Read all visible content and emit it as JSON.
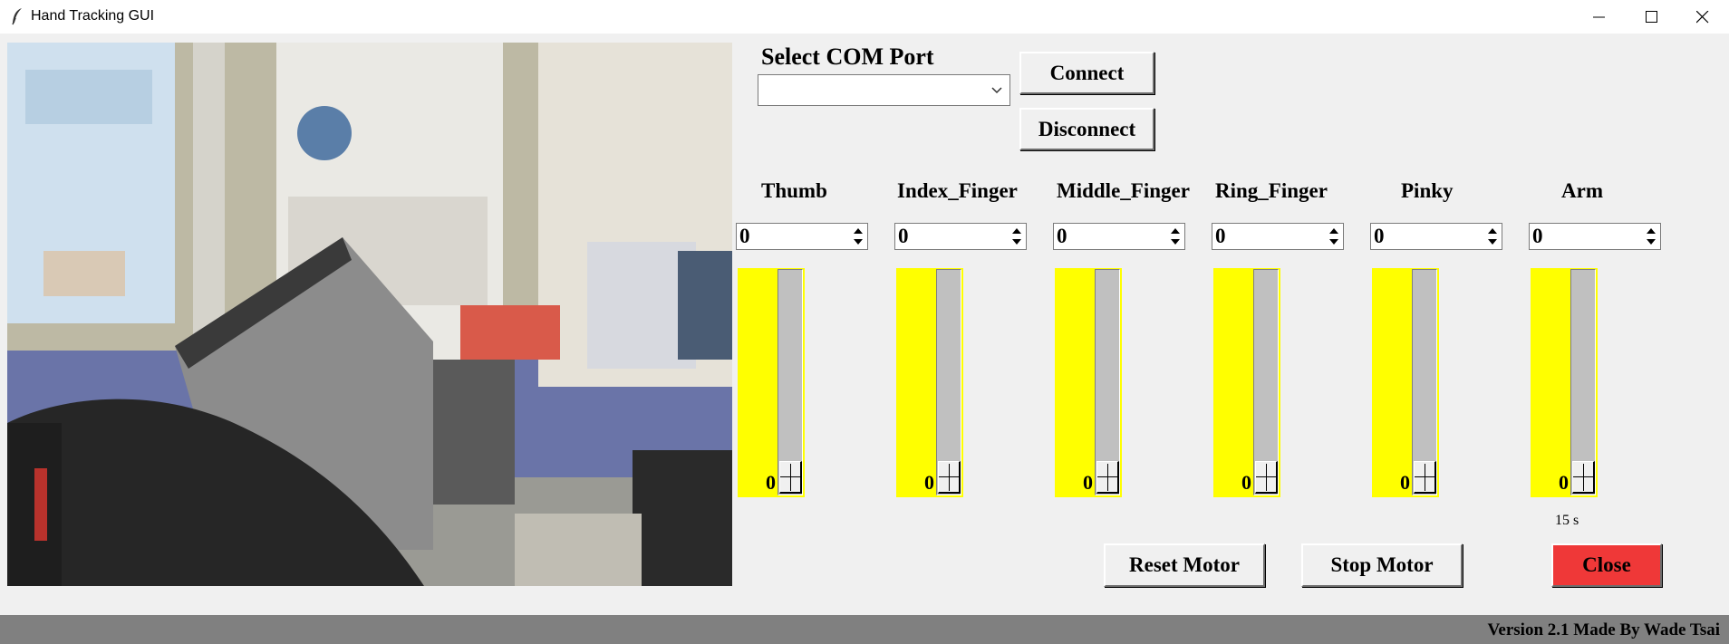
{
  "window": {
    "title": "Hand Tracking GUI",
    "icons": [
      "feather-icon",
      "minimize-icon",
      "maximize-icon",
      "close-icon"
    ]
  },
  "com": {
    "label": "Select COM Port",
    "selected": "",
    "connect_label": "Connect",
    "disconnect_label": "Disconnect"
  },
  "joints": [
    {
      "name": "Thumb",
      "value": "0",
      "slider_value": "0",
      "level": 0
    },
    {
      "name": "Index_Finger",
      "value": "0",
      "slider_value": "0",
      "level": 0
    },
    {
      "name": "Middle_Finger",
      "value": "0",
      "slider_value": "0",
      "level": 0
    },
    {
      "name": "Ring_Finger",
      "value": "0",
      "slider_value": "0",
      "level": 0
    },
    {
      "name": "Pinky",
      "value": "0",
      "slider_value": "0",
      "level": 0
    },
    {
      "name": "Arm",
      "value": "0",
      "slider_value": "0",
      "level": 0
    }
  ],
  "timer": "15 s",
  "buttons": {
    "reset": "Reset Motor",
    "stop": "Stop Motor",
    "close": "Close"
  },
  "status": "Version 2.1  Made By Wade Tsai",
  "colors": {
    "slider_bg": "#ffff00",
    "close_button": "#ef3838",
    "status_bar": "#808080"
  }
}
